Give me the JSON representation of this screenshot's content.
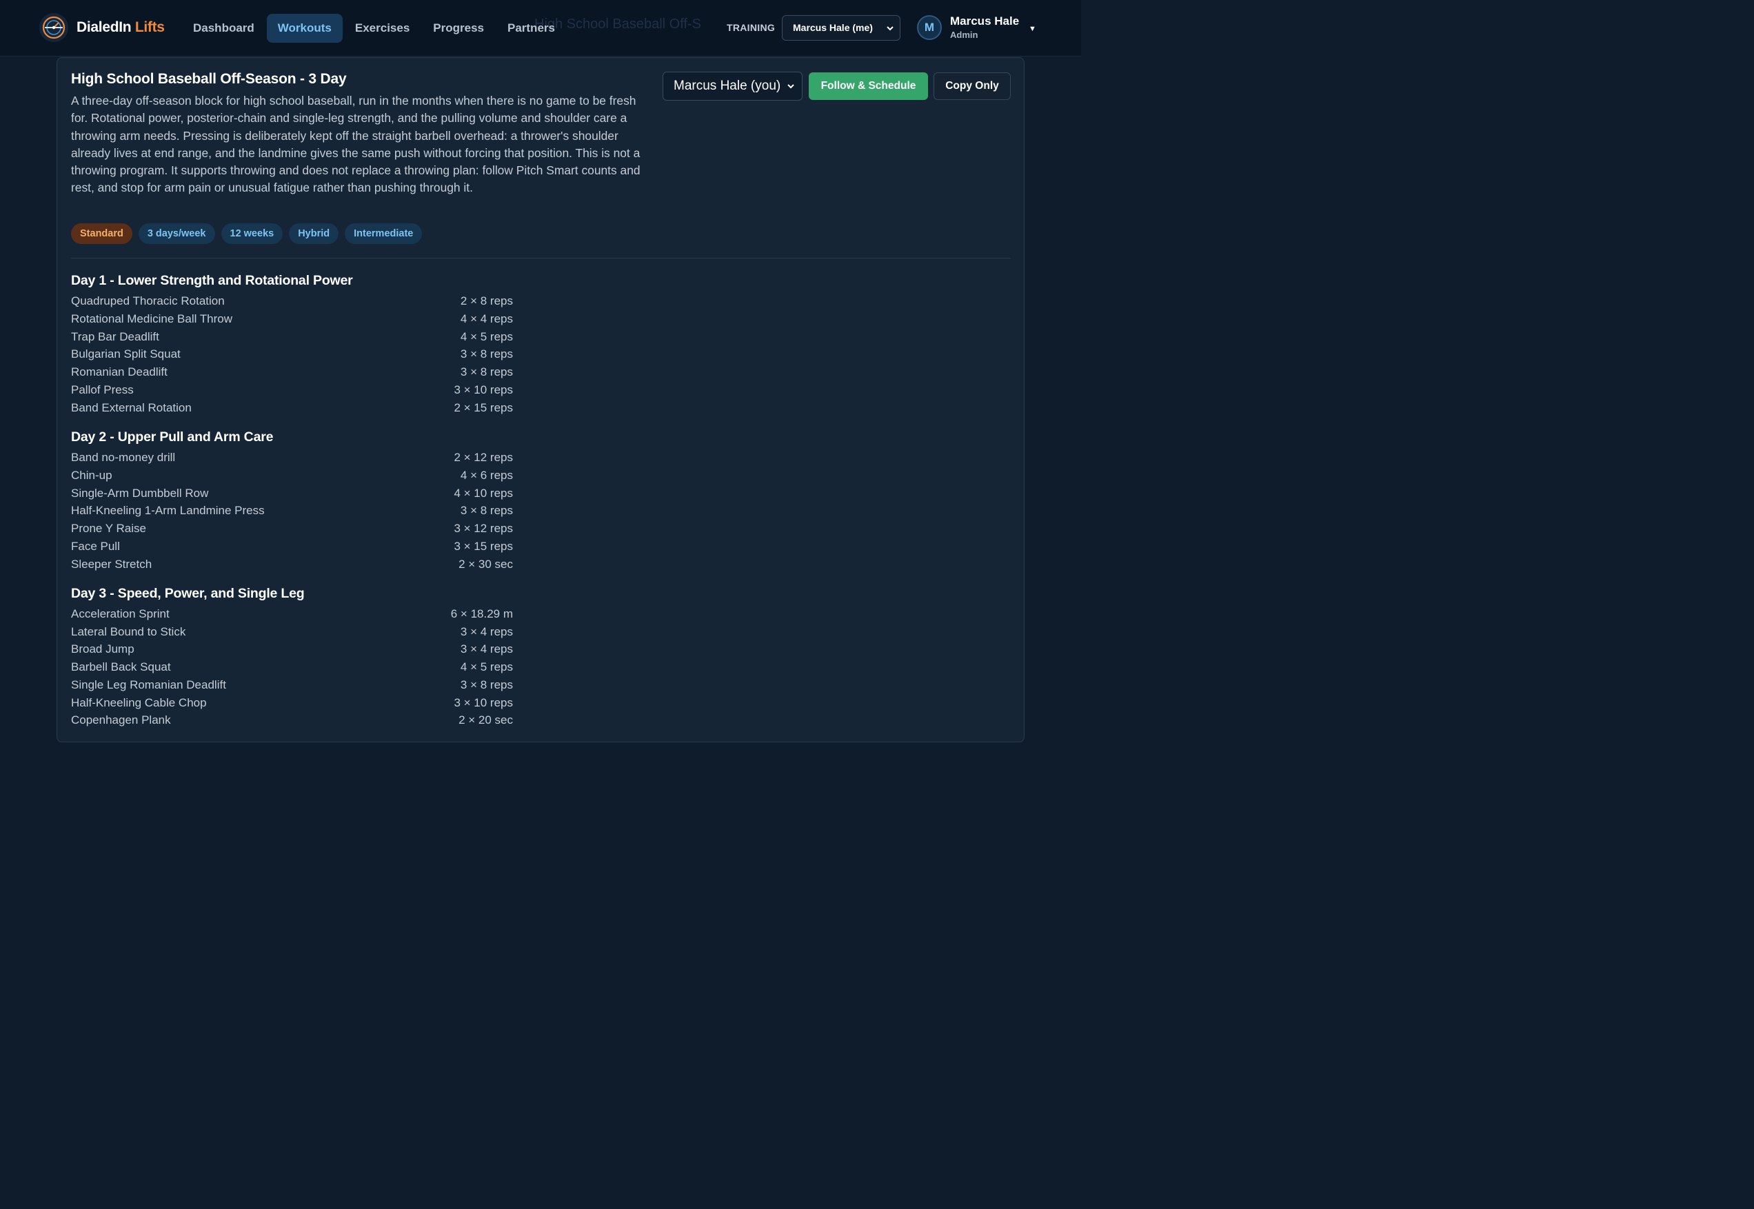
{
  "header": {
    "brand_primary": "DialedIn",
    "brand_accent": "Lifts",
    "ghost_text": "High School Baseball Off-S",
    "nav": [
      {
        "label": "Dashboard",
        "active": false
      },
      {
        "label": "Workouts",
        "active": true
      },
      {
        "label": "Exercises",
        "active": false
      },
      {
        "label": "Progress",
        "active": false
      },
      {
        "label": "Partners",
        "active": false
      }
    ],
    "training_label": "TRAINING",
    "training_select_value": "Marcus Hale (me)",
    "user": {
      "initial": "M",
      "name": "Marcus Hale",
      "role": "Admin"
    }
  },
  "program": {
    "title": "High School Baseball Off-Season - 3 Day",
    "description": "A three-day off-season block for high school baseball, run in the months when there is no game to be fresh for. Rotational power, posterior-chain and single-leg strength, and the pulling volume and shoulder care a throwing arm needs. Pressing is deliberately kept off the straight barbell overhead: a thrower's shoulder already lives at end range, and the landmine gives the same push without forcing that position. This is not a throwing program. It supports throwing and does not replace a throwing plan: follow Pitch Smart counts and rest, and stop for arm pain or unusual fatigue rather than pushing through it.",
    "owner_select_value": "Marcus Hale (you)",
    "follow_button": "Follow & Schedule",
    "copy_button": "Copy Only",
    "tags": [
      "Standard",
      "3 days/week",
      "12 weeks",
      "Hybrid",
      "Intermediate"
    ],
    "days": [
      {
        "title": "Day 1 - Lower Strength and Rotational Power",
        "exercises": [
          {
            "name": "Quadruped Thoracic Rotation",
            "sets": "2 × 8 reps"
          },
          {
            "name": "Rotational Medicine Ball Throw",
            "sets": "4 × 4 reps"
          },
          {
            "name": "Trap Bar Deadlift",
            "sets": "4 × 5 reps"
          },
          {
            "name": "Bulgarian Split Squat",
            "sets": "3 × 8 reps"
          },
          {
            "name": "Romanian Deadlift",
            "sets": "3 × 8 reps"
          },
          {
            "name": "Pallof Press",
            "sets": "3 × 10 reps"
          },
          {
            "name": "Band External Rotation",
            "sets": "2 × 15 reps"
          }
        ]
      },
      {
        "title": "Day 2 - Upper Pull and Arm Care",
        "exercises": [
          {
            "name": "Band no-money drill",
            "sets": "2 × 12 reps"
          },
          {
            "name": "Chin-up",
            "sets": "4 × 6 reps"
          },
          {
            "name": "Single-Arm Dumbbell Row",
            "sets": "4 × 10 reps"
          },
          {
            "name": "Half-Kneeling 1-Arm Landmine Press",
            "sets": "3 × 8 reps"
          },
          {
            "name": "Prone Y Raise",
            "sets": "3 × 12 reps"
          },
          {
            "name": "Face Pull",
            "sets": "3 × 15 reps"
          },
          {
            "name": "Sleeper Stretch",
            "sets": "2 × 30 sec"
          }
        ]
      },
      {
        "title": "Day 3 - Speed, Power, and Single Leg",
        "exercises": [
          {
            "name": "Acceleration Sprint",
            "sets": "6 × 18.29 m"
          },
          {
            "name": "Lateral Bound to Stick",
            "sets": "3 × 4 reps"
          },
          {
            "name": "Broad Jump",
            "sets": "3 × 4 reps"
          },
          {
            "name": "Barbell Back Squat",
            "sets": "4 × 5 reps"
          },
          {
            "name": "Single Leg Romanian Deadlift",
            "sets": "3 × 8 reps"
          },
          {
            "name": "Half-Kneeling Cable Chop",
            "sets": "3 × 10 reps"
          },
          {
            "name": "Copenhagen Plank",
            "sets": "2 × 20 sec"
          }
        ]
      }
    ]
  }
}
